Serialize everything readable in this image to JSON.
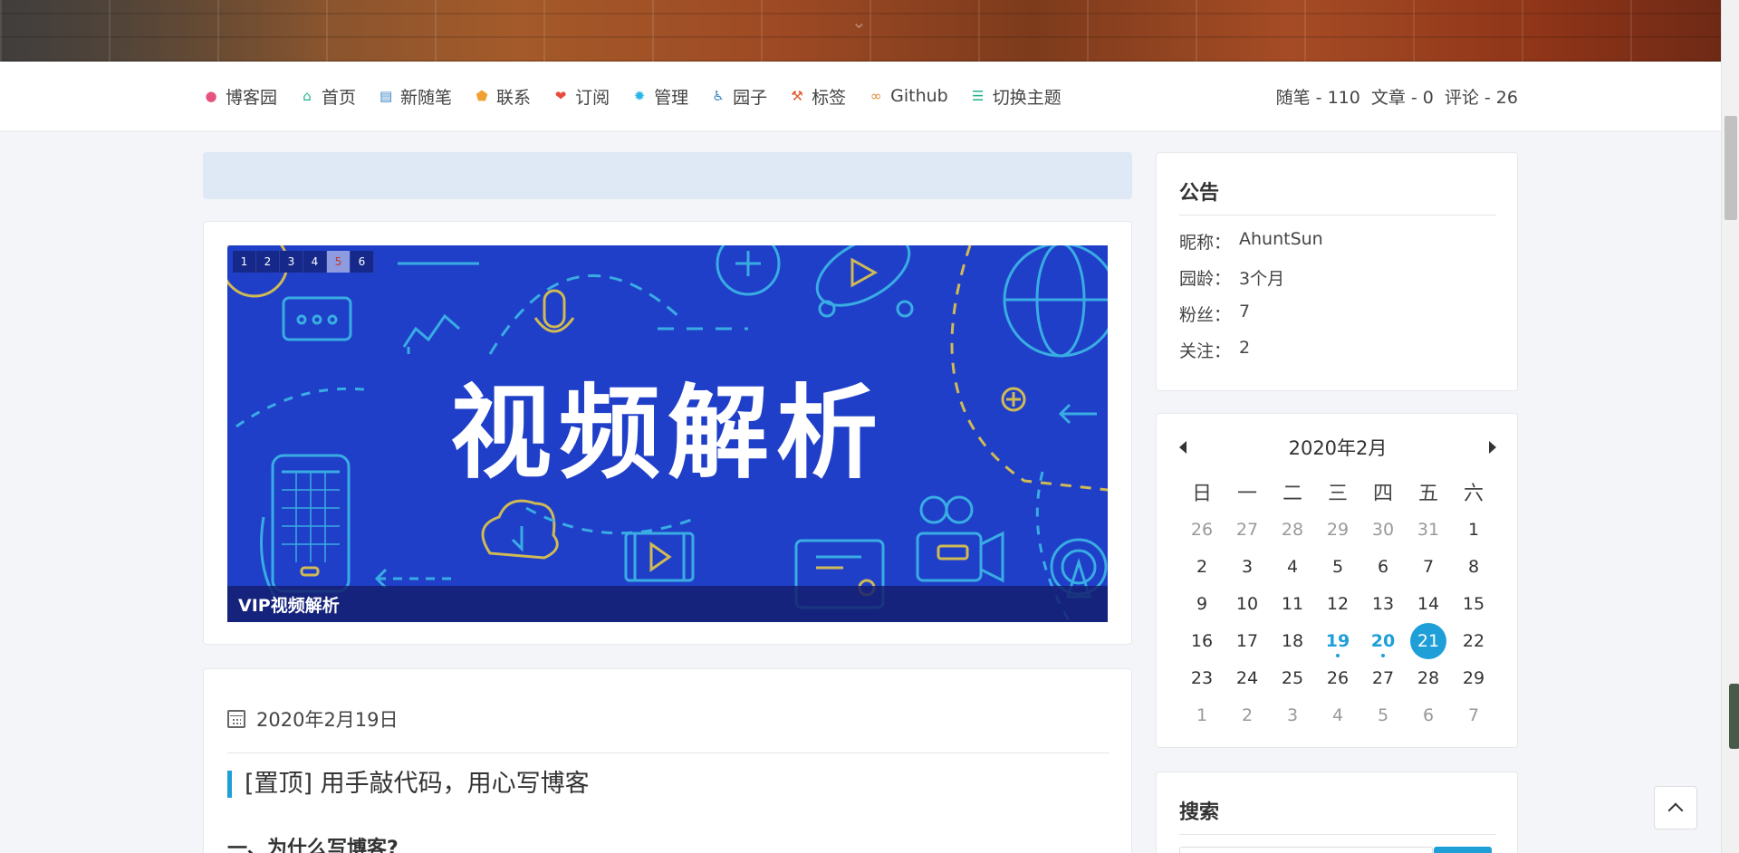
{
  "nav": {
    "items": [
      {
        "label": "博客园",
        "icon": "paw-icon",
        "color": "#e4547e"
      },
      {
        "label": "首页",
        "icon": "home-icon",
        "color": "#1db08a"
      },
      {
        "label": "新随笔",
        "icon": "edit-icon",
        "color": "#3b86c6"
      },
      {
        "label": "联系",
        "icon": "envelope-icon",
        "color": "#f0a030"
      },
      {
        "label": "订阅",
        "icon": "heart-icon",
        "color": "#e74c3c"
      },
      {
        "label": "管理",
        "icon": "gear-icon",
        "color": "#29b6e6"
      },
      {
        "label": "园子",
        "icon": "accessibility-icon",
        "color": "#3b86c6"
      },
      {
        "label": "标签",
        "icon": "wrench-icon",
        "color": "#e05a2a"
      },
      {
        "label": "Github",
        "icon": "link-icon",
        "color": "#e08a30"
      },
      {
        "label": "切换主题",
        "icon": "sliders-icon",
        "color": "#1db08a"
      }
    ],
    "stats": [
      "随笔 - 110",
      "文章 - 0",
      "评论 - 26"
    ]
  },
  "slider": {
    "title": "视频解析",
    "caption": "VIP视频解析",
    "dots": [
      "1",
      "2",
      "3",
      "4",
      "5",
      "6"
    ],
    "active_dot": 4
  },
  "post": {
    "date": "2020年2月19日",
    "title": "[置顶] 用手敲代码，用心写博客",
    "subtitle": "一、为什么写博客?"
  },
  "notice": {
    "title": "公告",
    "rows": [
      {
        "key": "昵称：",
        "value": "AhuntSun"
      },
      {
        "key": "园龄：",
        "value": "3个月"
      },
      {
        "key": "粉丝：",
        "value": "7"
      },
      {
        "key": "关注：",
        "value": "2"
      }
    ]
  },
  "calendar": {
    "month": "2020年2月",
    "weekdays": [
      "日",
      "一",
      "二",
      "三",
      "四",
      "五",
      "六"
    ],
    "weeks": [
      [
        "26",
        "27",
        "28",
        "29",
        "30",
        "31",
        "1"
      ],
      [
        "2",
        "3",
        "4",
        "5",
        "6",
        "7",
        "8"
      ],
      [
        "9",
        "10",
        "11",
        "12",
        "13",
        "14",
        "15"
      ],
      [
        "16",
        "17",
        "18",
        "19",
        "20",
        "21",
        "22"
      ],
      [
        "23",
        "24",
        "25",
        "26",
        "27",
        "28",
        "29"
      ],
      [
        "1",
        "2",
        "3",
        "4",
        "5",
        "6",
        "7"
      ]
    ],
    "other_month_cells": [
      [
        0,
        0
      ],
      [
        0,
        1
      ],
      [
        0,
        2
      ],
      [
        0,
        3
      ],
      [
        0,
        4
      ],
      [
        0,
        5
      ],
      [
        5,
        0
      ],
      [
        5,
        1
      ],
      [
        5,
        2
      ],
      [
        5,
        3
      ],
      [
        5,
        4
      ],
      [
        5,
        5
      ],
      [
        5,
        6
      ]
    ],
    "linked_days": [
      "19",
      "20"
    ],
    "today": "21"
  },
  "search": {
    "title": "搜索"
  },
  "colors": {
    "accent": "#1e9fd8",
    "slider_bg": "#1f3fc8"
  }
}
